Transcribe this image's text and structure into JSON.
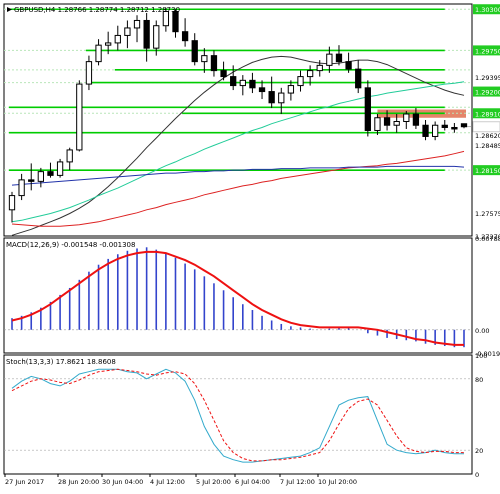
{
  "chart_data": [
    {
      "type": "candlestick",
      "panel": "price",
      "title": "GBPUSD,H4 1.28766 1.28774 1.28712 1.28730",
      "y_ticks": [
        "1.30300",
        "1.29750",
        "1.29395",
        "1.29200",
        "1.28910",
        "1.28620",
        "1.28485",
        "1.28150",
        "1.27575",
        "1.27270"
      ],
      "ylim": [
        1.2727,
        1.3037
      ],
      "colors": {
        "bull": "#ffffff",
        "bear": "#000000",
        "level_line": "#00cc00",
        "zone": "#e07050",
        "highlight_label": "#22cc22"
      },
      "levels": [
        1.303,
        1.2975,
        1.2949,
        1.2932,
        1.2899,
        1.2891,
        1.2865,
        1.2815
      ],
      "zone": [
        1.2885,
        1.2896
      ],
      "highlighted_tick_labels": [
        "1.30300",
        "1.29750",
        "1.29200",
        "1.28910",
        "1.28150"
      ],
      "series": [
        {
          "kind": "ohlc",
          "color": "#000000",
          "values": [
            [
              1.2762,
              1.2786,
              1.2745,
              1.2781
            ],
            [
              1.2781,
              1.281,
              1.2775,
              1.2802
            ],
            [
              1.2802,
              1.2824,
              1.2788,
              1.28
            ],
            [
              1.28,
              1.2818,
              1.2792,
              1.2813
            ],
            [
              1.2813,
              1.2825,
              1.2805,
              1.2808
            ],
            [
              1.2808,
              1.283,
              1.2805,
              1.2826
            ],
            [
              1.2826,
              1.2845,
              1.2815,
              1.2842
            ],
            [
              1.2842,
              1.2935,
              1.284,
              1.293
            ],
            [
              1.293,
              1.2968,
              1.2922,
              1.296
            ],
            [
              1.296,
              1.299,
              1.2955,
              1.2982
            ],
            [
              1.2982,
              1.3,
              1.297,
              1.2985
            ],
            [
              1.2985,
              1.3008,
              1.2975,
              1.2995
            ],
            [
              1.2995,
              1.3015,
              1.2978,
              1.3005
            ],
            [
              1.3005,
              1.3022,
              1.2986,
              1.3015
            ],
            [
              1.3015,
              1.3025,
              1.296,
              1.2978
            ],
            [
              1.2978,
              1.3015,
              1.2968,
              1.3008
            ],
            [
              1.3008,
              1.3032,
              1.3,
              1.3027
            ],
            [
              1.3027,
              1.303,
              1.2992,
              1.3
            ],
            [
              1.3,
              1.3018,
              1.298,
              1.2988
            ],
            [
              1.2988,
              1.2998,
              1.2955,
              1.296
            ],
            [
              1.296,
              1.2978,
              1.2945,
              1.2968
            ],
            [
              1.2968,
              1.2975,
              1.294,
              1.2948
            ],
            [
              1.2948,
              1.296,
              1.2935,
              1.294
            ],
            [
              1.294,
              1.2955,
              1.2922,
              1.2928
            ],
            [
              1.2928,
              1.2942,
              1.2915,
              1.2935
            ],
            [
              1.2935,
              1.2945,
              1.2918,
              1.2925
            ],
            [
              1.2925,
              1.2935,
              1.291,
              1.292
            ],
            [
              1.292,
              1.294,
              1.2898,
              1.2905
            ],
            [
              1.2905,
              1.2925,
              1.289,
              1.2918
            ],
            [
              1.2918,
              1.2935,
              1.2908,
              1.2928
            ],
            [
              1.2928,
              1.2948,
              1.292,
              1.294
            ],
            [
              1.294,
              1.2955,
              1.2928,
              1.2948
            ],
            [
              1.2948,
              1.2962,
              1.294,
              1.2955
            ],
            [
              1.2955,
              1.298,
              1.2945,
              1.297
            ],
            [
              1.297,
              1.2982,
              1.2955,
              1.296
            ],
            [
              1.296,
              1.2972,
              1.2945,
              1.295
            ],
            [
              1.295,
              1.2962,
              1.2918,
              1.2925
            ],
            [
              1.2925,
              1.2935,
              1.286,
              1.2868
            ],
            [
              1.2868,
              1.289,
              1.2862,
              1.2885
            ],
            [
              1.2885,
              1.2895,
              1.2868,
              1.2875
            ],
            [
              1.2875,
              1.289,
              1.2865,
              1.288
            ],
            [
              1.288,
              1.2894,
              1.287,
              1.289
            ],
            [
              1.289,
              1.2898,
              1.287,
              1.2875
            ],
            [
              1.2875,
              1.2882,
              1.2855,
              1.286
            ],
            [
              1.286,
              1.288,
              1.2855,
              1.2875
            ],
            [
              1.2875,
              1.2882,
              1.2868,
              1.2872
            ],
            [
              1.2872,
              1.2878,
              1.2865,
              1.287
            ],
            [
              1.2877,
              1.2877,
              1.2871,
              1.2873
            ]
          ]
        },
        {
          "kind": "ma",
          "name": "",
          "color": "#333333",
          "values": [
            1.2728,
            1.2732,
            1.2736,
            1.2741,
            1.2746,
            1.2751,
            1.2757,
            1.2764,
            1.2772,
            1.2782,
            1.2793,
            1.2805,
            1.2818,
            1.2831,
            1.2845,
            1.2858,
            1.2871,
            1.2884,
            1.2896,
            1.2908,
            1.2919,
            1.2929,
            1.2938,
            1.2946,
            1.2953,
            1.2959,
            1.2963,
            1.2966,
            1.2967,
            1.2966,
            1.2963,
            1.296,
            1.2958,
            1.2957,
            1.2958,
            1.296,
            1.2962,
            1.2962,
            1.296,
            1.2956,
            1.295,
            1.2944,
            1.2938,
            1.2932,
            1.2927,
            1.2922,
            1.2918,
            1.2915
          ]
        },
        {
          "kind": "ma",
          "name": "",
          "color": "#22cc99",
          "values": [
            1.2746,
            1.2748,
            1.2751,
            1.2754,
            1.2757,
            1.2761,
            1.2765,
            1.277,
            1.2775,
            1.2781,
            1.2786,
            1.2791,
            1.2797,
            1.2803,
            1.2809,
            1.2815,
            1.2821,
            1.2826,
            1.2832,
            1.2837,
            1.2843,
            1.2848,
            1.2853,
            1.2858,
            1.2863,
            1.2868,
            1.2872,
            1.2877,
            1.2881,
            1.2885,
            1.2889,
            1.2893,
            1.2897,
            1.29,
            1.2904,
            1.2907,
            1.291,
            1.2913,
            1.2915,
            1.2918,
            1.292,
            1.2922,
            1.2924,
            1.2926,
            1.2928,
            1.293,
            1.2931,
            1.2933
          ]
        },
        {
          "kind": "ma",
          "name": "",
          "color": "#dd2222",
          "values": [
            1.2743,
            1.2742,
            1.2741,
            1.274,
            1.274,
            1.274,
            1.2741,
            1.2742,
            1.2744,
            1.2746,
            1.2749,
            1.2752,
            1.2755,
            1.2758,
            1.2762,
            1.2765,
            1.2769,
            1.2772,
            1.2775,
            1.2778,
            1.2782,
            1.2785,
            1.2788,
            1.2791,
            1.2794,
            1.2796,
            1.2799,
            1.2801,
            1.2804,
            1.2806,
            1.2808,
            1.281,
            1.2812,
            1.2814,
            1.2816,
            1.2818,
            1.2819,
            1.282,
            1.2821,
            1.2823,
            1.2824,
            1.2826,
            1.2828,
            1.283,
            1.2832,
            1.2834,
            1.2837,
            1.284
          ]
        },
        {
          "kind": "ma",
          "name": "",
          "color": "#2233aa",
          "values": [
            1.2795,
            1.2796,
            1.2797,
            1.2798,
            1.2799,
            1.28,
            1.2801,
            1.2802,
            1.2803,
            1.2804,
            1.2805,
            1.2806,
            1.2807,
            1.2808,
            1.2809,
            1.281,
            1.2811,
            1.2811,
            1.2812,
            1.2813,
            1.2813,
            1.2814,
            1.2814,
            1.2815,
            1.2815,
            1.2816,
            1.2816,
            1.2816,
            1.2817,
            1.2817,
            1.2817,
            1.2818,
            1.2818,
            1.2818,
            1.2818,
            1.2819,
            1.2819,
            1.2819,
            1.2819,
            1.282,
            1.282,
            1.282,
            1.282,
            1.282,
            1.282,
            1.282,
            1.282,
            1.2819
          ]
        }
      ]
    },
    {
      "type": "bar",
      "panel": "macd",
      "title": "MACD(12,26,9) -0.001548 -0.001308",
      "y_ticks": [
        "0.007883",
        "0.00",
        "-0.001997"
      ],
      "ylim": [
        -0.002,
        0.0079
      ],
      "colors": {
        "histogram": "#3344cc",
        "signal": "#ee1111"
      },
      "series": [
        {
          "name": "histogram",
          "values": [
            0.001,
            0.0012,
            0.0015,
            0.0019,
            0.0024,
            0.003,
            0.0036,
            0.0043,
            0.005,
            0.0056,
            0.0061,
            0.0065,
            0.0068,
            0.007,
            0.0071,
            0.0069,
            0.0066,
            0.0062,
            0.0057,
            0.0052,
            0.0046,
            0.004,
            0.0034,
            0.0028,
            0.0022,
            0.0017,
            0.0012,
            0.0008,
            0.0005,
            0.0003,
            0.0002,
            0.0001,
            0.0,
            0.0001,
            0.0002,
            0.0002,
            0.0,
            -0.0003,
            -0.0005,
            -0.0007,
            -0.0008,
            -0.0009,
            -0.001,
            -0.0012,
            -0.0013,
            -0.0014,
            -0.0015,
            -0.0015
          ]
        },
        {
          "name": "signal",
          "values": [
            0.0008,
            0.001,
            0.0013,
            0.0017,
            0.0022,
            0.0028,
            0.0034,
            0.004,
            0.0046,
            0.0052,
            0.0057,
            0.0061,
            0.0064,
            0.0066,
            0.0067,
            0.0067,
            0.0066,
            0.0063,
            0.006,
            0.0056,
            0.0051,
            0.0046,
            0.004,
            0.0034,
            0.0028,
            0.0022,
            0.0017,
            0.0013,
            0.0009,
            0.0006,
            0.0004,
            0.0003,
            0.0002,
            0.0002,
            0.0002,
            0.0002,
            0.0002,
            0.0001,
            0.0,
            -0.0002,
            -0.0004,
            -0.0006,
            -0.0008,
            -0.0009,
            -0.0011,
            -0.0012,
            -0.0013,
            -0.0013
          ]
        }
      ]
    },
    {
      "type": "line",
      "panel": "stoch",
      "title": "Stoch(13,3,3) 17.8621 18.8608",
      "y_ticks": [
        "100",
        "80",
        "20",
        "0"
      ],
      "ylim": [
        0,
        100
      ],
      "colors": {
        "main": "#33aacc",
        "signal": "#ee1111"
      },
      "series": [
        {
          "name": "main",
          "dash": false,
          "values": [
            72,
            78,
            82,
            80,
            76,
            74,
            78,
            84,
            86,
            88,
            88,
            88,
            86,
            85,
            80,
            84,
            88,
            85,
            78,
            62,
            40,
            25,
            15,
            12,
            10,
            10,
            11,
            12,
            13,
            14,
            15,
            18,
            22,
            40,
            58,
            62,
            64,
            65,
            45,
            25,
            20,
            18,
            17,
            18,
            20,
            18,
            17,
            17
          ]
        },
        {
          "name": "signal",
          "dash": true,
          "values": [
            70,
            74,
            78,
            80,
            79,
            77,
            76,
            79,
            83,
            86,
            87,
            88,
            87,
            86,
            84,
            83,
            85,
            86,
            84,
            76,
            62,
            45,
            28,
            18,
            13,
            11,
            11,
            12,
            12,
            13,
            14,
            16,
            18,
            28,
            42,
            55,
            61,
            63,
            58,
            45,
            32,
            22,
            19,
            18,
            19,
            19,
            18,
            18
          ]
        }
      ]
    }
  ],
  "x_ticks": [
    "27 Jun 2017",
    "28 Jun 20:00",
    "30 Jun 04:00",
    "4 Jul 12:00",
    "5 Jul 20:00",
    "6 Jul 04:00",
    "7 Jul 12:00",
    "10 Jul 20:00"
  ],
  "x_tick_index": [
    0,
    9,
    18,
    27,
    32,
    39,
    47,
    47
  ]
}
